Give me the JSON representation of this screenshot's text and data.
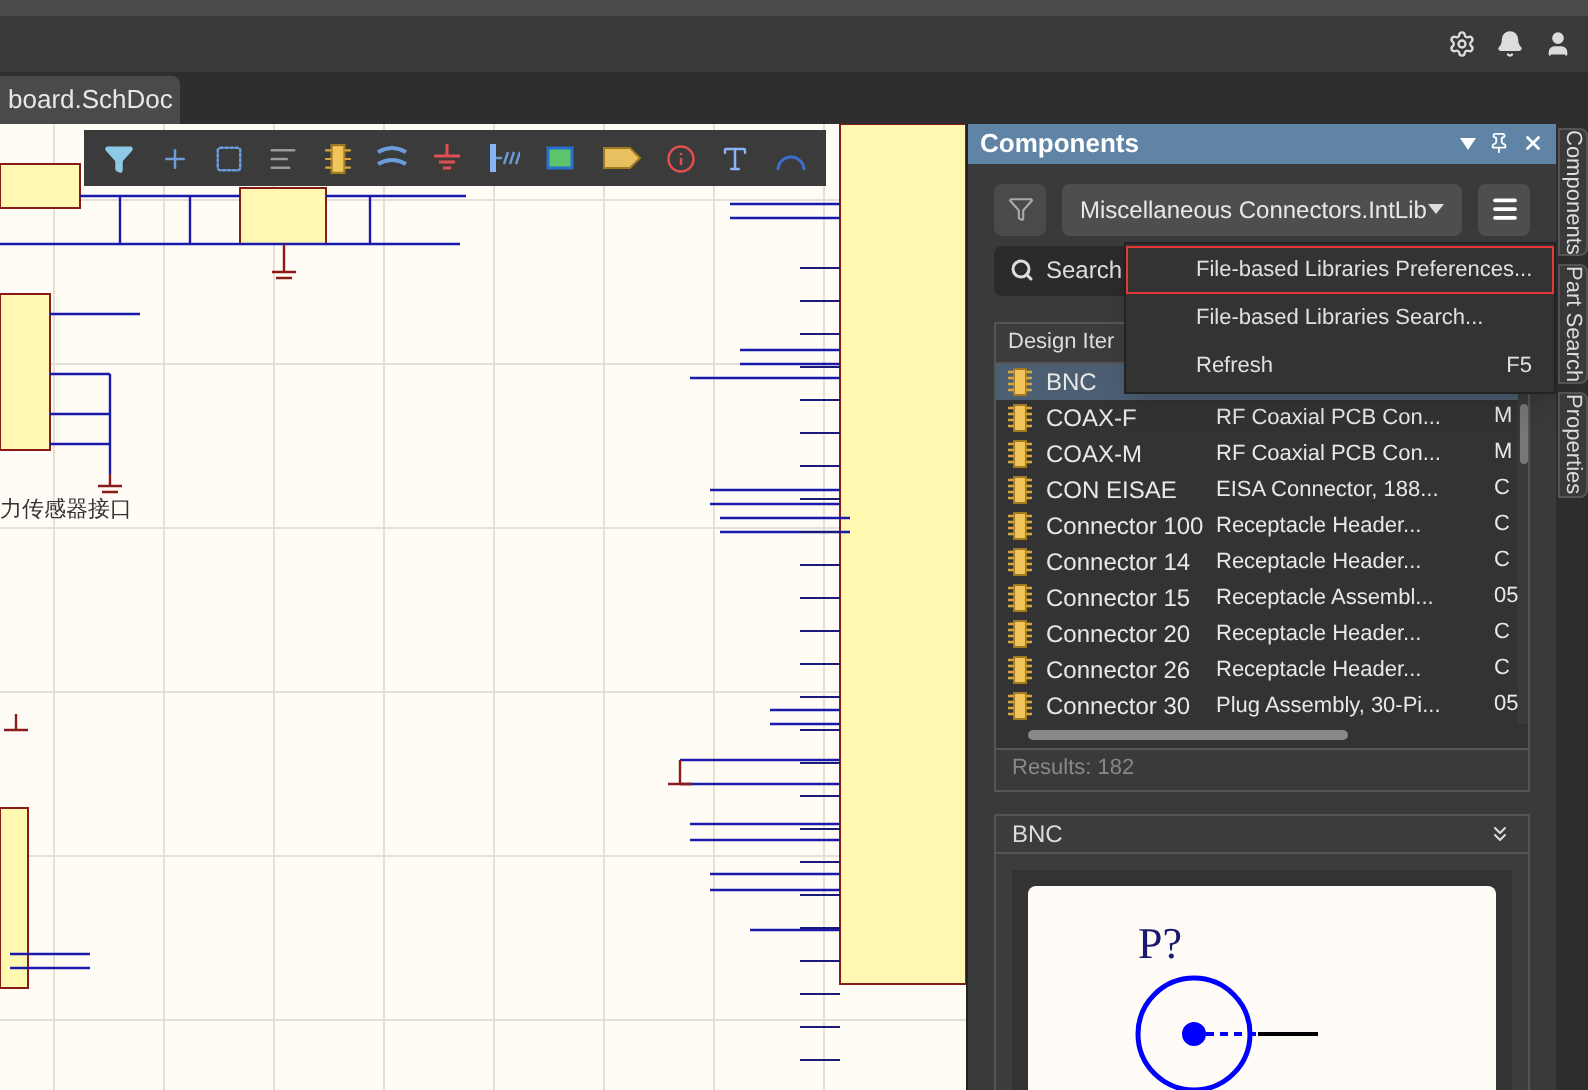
{
  "tab": {
    "label": "board.SchDoc",
    "selected": true
  },
  "canvas": {
    "caption": "力传感器接口"
  },
  "panel": {
    "title": "Components",
    "library": "Miscellaneous Connectors.IntLib",
    "search": {
      "placeholder": "Search"
    },
    "table": {
      "columns": [
        "Design Iter"
      ],
      "rows": [
        {
          "name": "BNC",
          "selected": true
        },
        {
          "name": "COAX-F",
          "description": "RF Coaxial PCB Con...",
          "column_3": "M",
          "selected": false
        },
        {
          "name": "COAX-M",
          "description": "RF Coaxial PCB Con...",
          "column_3": "M",
          "selected": false
        },
        {
          "name": "CON EISAE",
          "description": "EISA Connector, 188...",
          "column_3": "C",
          "selected": false
        },
        {
          "name": "Connector 100",
          "description": "Receptacle Header...",
          "column_3": "C",
          "selected": false
        },
        {
          "name": "Connector 14",
          "description": "Receptacle Header...",
          "column_3": "C",
          "selected": false
        },
        {
          "name": "Connector 15",
          "description": "Receptacle Assembl...",
          "column_3": "05",
          "selected": false
        },
        {
          "name": "Connector 20",
          "description": "Receptacle Header...",
          "column_3": "C",
          "selected": false
        },
        {
          "name": "Connector 26",
          "description": "Receptacle Header...",
          "column_3": "C",
          "selected": false
        },
        {
          "name": "Connector 30",
          "description": "Plug Assembly, 30-Pi...",
          "column_3": "05",
          "selected": false
        }
      ]
    },
    "results": "Results: 182",
    "preview": {
      "title": "BNC",
      "designator": "P?"
    }
  },
  "menu": {
    "items": [
      {
        "label": "File-based Libraries Preferences...",
        "selected": true
      },
      {
        "label": "File-based Libraries Search...",
        "selected": false
      },
      {
        "label": "Refresh",
        "shortcut": "F5",
        "selected": false
      }
    ]
  },
  "side_tabs": [
    {
      "label": "Components"
    },
    {
      "label": "Part Search"
    },
    {
      "label": "Properties"
    }
  ]
}
